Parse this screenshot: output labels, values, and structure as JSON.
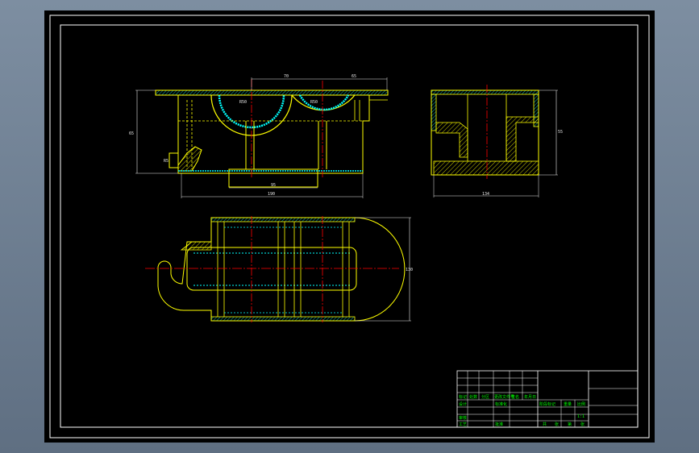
{
  "colors": {
    "background": "#000000",
    "frame": "#ffffff",
    "outline": "#ffff00",
    "hatch": "#00ffff",
    "centerline": "#ff0000",
    "dimension": "#e8e8e8",
    "titleblock_text": "#00ff00"
  },
  "front_view": {
    "dims": {
      "top_left": "70",
      "top_right": "65",
      "height_left": "65",
      "bottom_inner": "95",
      "bottom_overall": "190",
      "small_left": "R5",
      "bore_left": "R50",
      "bore_right": "R50"
    }
  },
  "side_view": {
    "dims": {
      "height_right": "55",
      "bottom_width": "134"
    }
  },
  "top_view": {
    "dims": {
      "height_right": "130"
    }
  },
  "title_block": {
    "labels": {
      "mark": "标记",
      "count": "处数",
      "zone": "分区",
      "change_doc": "更改文件号",
      "signature": "签名",
      "date": "年月日",
      "design": "设计",
      "standardize": "标准化",
      "review": "审核",
      "process": "工艺",
      "approve": "批准",
      "stage_mark": "阶段标记",
      "weight": "重量",
      "scale": "比例",
      "scale_value": "1:1",
      "sheets_total": "共",
      "sheet": "张",
      "sheet_no": "第"
    }
  }
}
